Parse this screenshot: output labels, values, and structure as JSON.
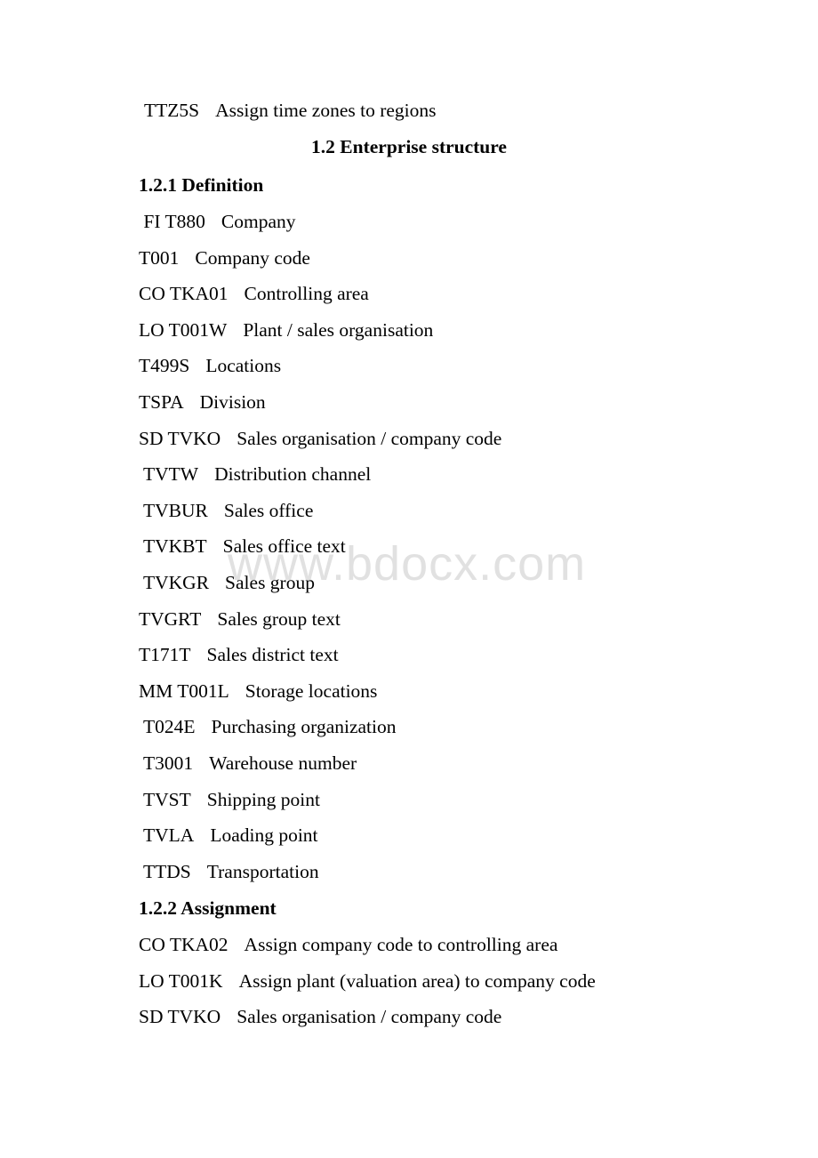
{
  "document": {
    "top_line": {
      "code": "TTZ5S",
      "desc": "Assign time zones to regions"
    },
    "section_title": "1.2 Enterprise structure",
    "subsections": [
      {
        "title": "1.2.1 Definition",
        "entries": [
          {
            "code": " FI T880",
            "desc": "Company"
          },
          {
            "code": "T001",
            "desc": "Company code"
          },
          {
            "code": "CO TKA01",
            "desc": "Controlling area"
          },
          {
            "code": "LO T001W",
            "desc": "Plant / sales organisation"
          },
          {
            "code": "T499S",
            "desc": "Locations"
          },
          {
            "code": "TSPA",
            "desc": "Division"
          },
          {
            "code": "SD TVKO",
            "desc": "Sales organisation / company code"
          },
          {
            "code": " TVTW",
            "desc": "Distribution channel"
          },
          {
            "code": " TVBUR",
            "desc": "Sales office"
          },
          {
            "code": " TVKBT",
            "desc": "Sales office text"
          },
          {
            "code": " TVKGR",
            "desc": "Sales group"
          },
          {
            "code": "TVGRT",
            "desc": "Sales group text"
          },
          {
            "code": "T171T",
            "desc": "Sales district text"
          },
          {
            "code": "MM T001L",
            "desc": "Storage locations"
          },
          {
            "code": " T024E",
            "desc": "Purchasing organization"
          },
          {
            "code": " T3001",
            "desc": "Warehouse number"
          },
          {
            "code": " TVST",
            "desc": "Shipping point"
          },
          {
            "code": " TVLA",
            "desc": "Loading point"
          },
          {
            "code": " TTDS",
            "desc": "Transportation"
          }
        ]
      },
      {
        "title": "1.2.2 Assignment",
        "entries": [
          {
            "code": "CO TKA02",
            "desc": "Assign company code to controlling area"
          },
          {
            "code": "LO T001K",
            "desc": "Assign plant (valuation area) to company code"
          },
          {
            "code": "SD TVKO",
            "desc": "Sales organisation / company code"
          }
        ]
      }
    ]
  },
  "watermark": "www.bdocx.com"
}
